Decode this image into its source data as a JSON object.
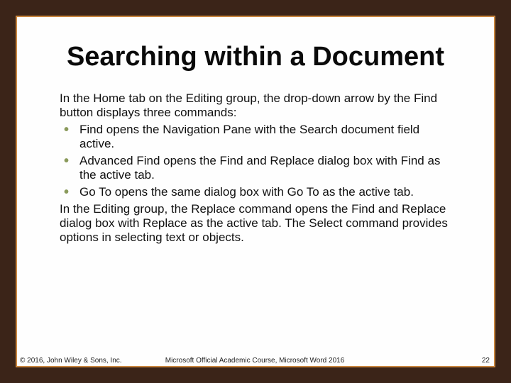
{
  "colors": {
    "background": "#3b2418",
    "frame_border": "#c9863f",
    "bullet": "#8a9a5b"
  },
  "slide": {
    "title": "Searching within a Document",
    "intro": "In the Home tab on the Editing group, the drop-down arrow by the Find button displays three commands:",
    "bullets": [
      "Find opens the Navigation Pane with the Search document field active.",
      "Advanced Find opens the Find and Replace dialog box with Find as the active tab.",
      "Go To opens the same dialog box with Go To as the active tab."
    ],
    "outro": "In the Editing group, the Replace command opens the Find and Replace dialog box with Replace as the active tab. The Select command provides options in selecting text or objects."
  },
  "footer": {
    "copyright": "© 2016, John Wiley & Sons, Inc.",
    "course": "Microsoft Official Academic Course, Microsoft Word 2016",
    "page_number": "22"
  }
}
